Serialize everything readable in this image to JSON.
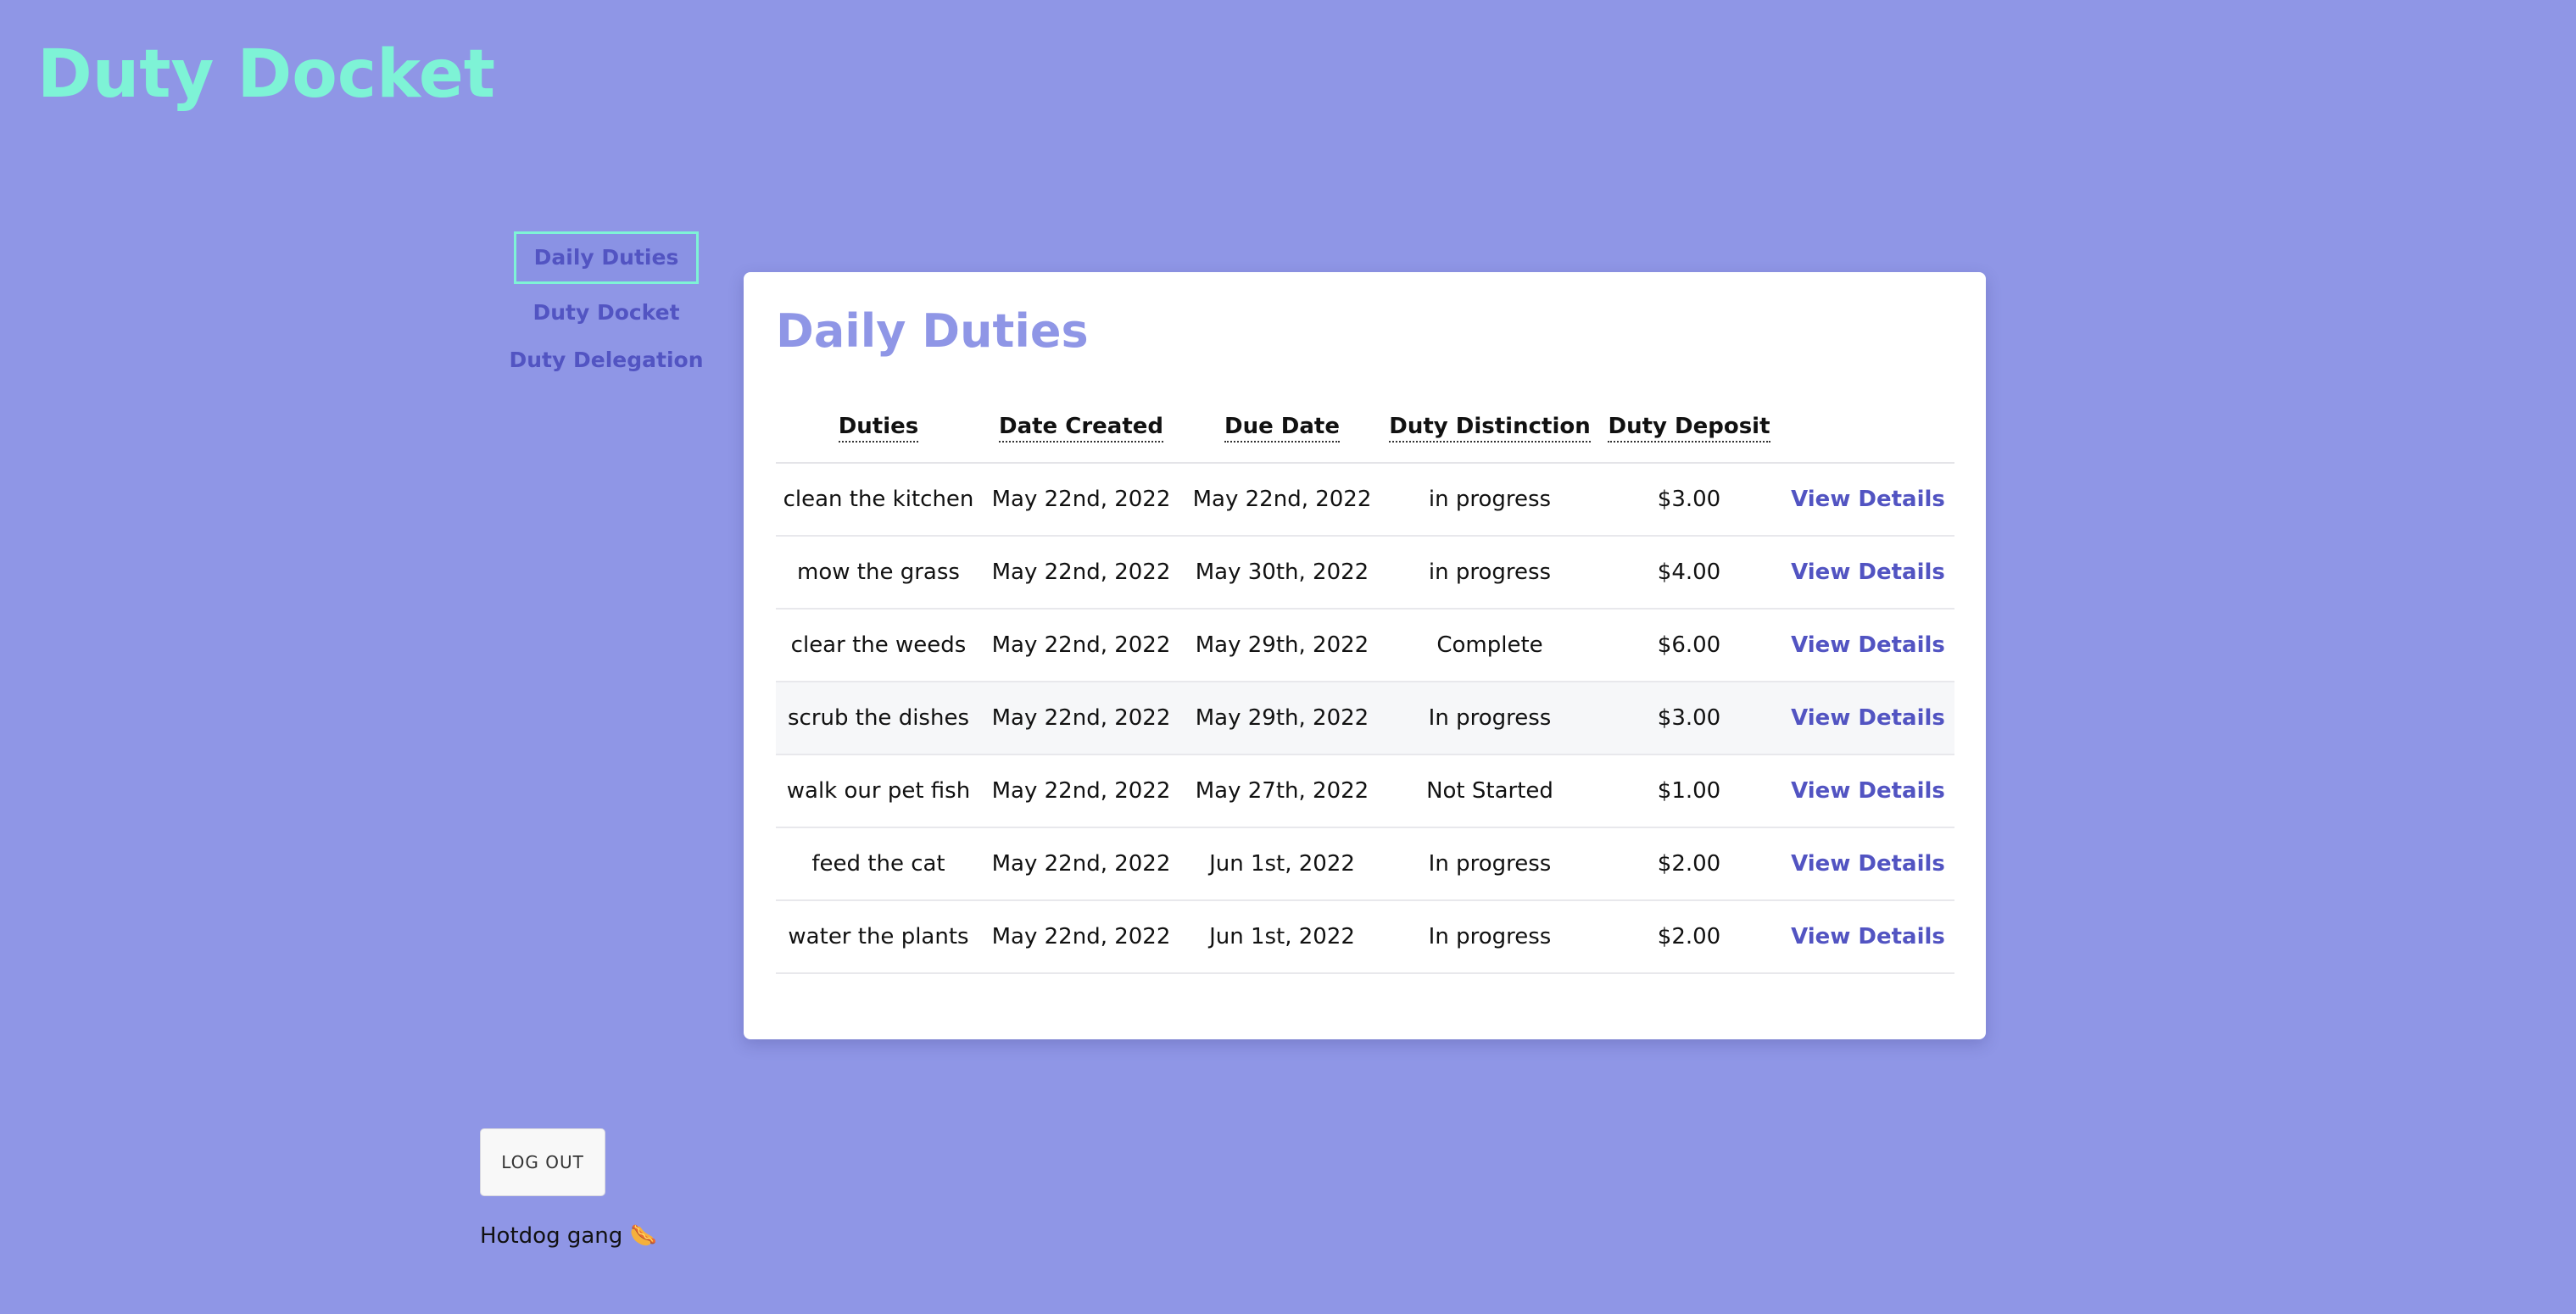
{
  "app": {
    "title": "Duty Docket"
  },
  "nav": {
    "items": [
      {
        "label": "Daily Duties",
        "active": true
      },
      {
        "label": "Duty Docket",
        "active": false
      },
      {
        "label": "Duty Delegation",
        "active": false
      }
    ]
  },
  "main": {
    "title": "Daily Duties",
    "table": {
      "headers": [
        "Duties",
        "Date Created",
        "Due Date",
        "Duty Distinction",
        "Duty Deposit"
      ],
      "rows": [
        {
          "duty": "clean the kitchen",
          "created": "May 22nd, 2022",
          "due": "May 22nd, 2022",
          "distinction": "in progress",
          "deposit": "$3.00",
          "action": "View Details"
        },
        {
          "duty": "mow the grass",
          "created": "May 22nd, 2022",
          "due": "May 30th, 2022",
          "distinction": "in progress",
          "deposit": "$4.00",
          "action": "View Details"
        },
        {
          "duty": "clear the weeds",
          "created": "May 22nd, 2022",
          "due": "May 29th, 2022",
          "distinction": "Complete",
          "deposit": "$6.00",
          "action": "View Details"
        },
        {
          "duty": "scrub the dishes",
          "created": "May 22nd, 2022",
          "due": "May 29th, 2022",
          "distinction": "In progress",
          "deposit": "$3.00",
          "action": "View Details"
        },
        {
          "duty": "walk our pet fish",
          "created": "May 22nd, 2022",
          "due": "May 27th, 2022",
          "distinction": "Not Started",
          "deposit": "$1.00",
          "action": "View Details"
        },
        {
          "duty": "feed the cat",
          "created": "May 22nd, 2022",
          "due": "Jun 1st, 2022",
          "distinction": "In progress",
          "deposit": "$2.00",
          "action": "View Details"
        },
        {
          "duty": "water the plants",
          "created": "May 22nd, 2022",
          "due": "Jun 1st, 2022",
          "distinction": "In progress",
          "deposit": "$2.00",
          "action": "View Details"
        }
      ]
    }
  },
  "footer": {
    "logout_label": "LOG OUT",
    "tagline": "Hotdog gang 🌭"
  },
  "colors": {
    "background": "#8f96e6",
    "brand_title": "#7ef3d6",
    "link": "#5254c2",
    "card": "#ffffff"
  }
}
